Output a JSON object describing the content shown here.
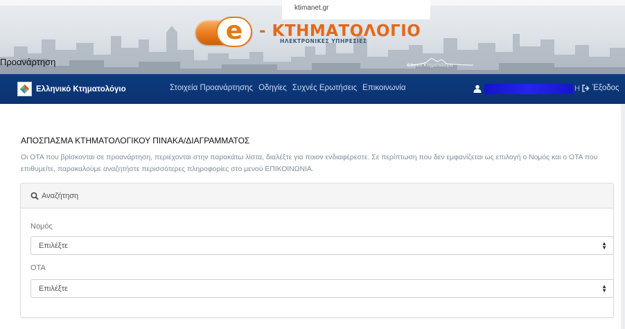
{
  "banner": {
    "url_text": "ktimanet.gr",
    "page_label": "Προανάρτηση",
    "logo_letter": "e",
    "logo_main": "- ΚΤΗΜΑΤΟΛΟΓΙΟ",
    "logo_sub": "ΗΛΕΚΤΡΟΝΙΚΕΣ ΥΠΗΡΕΣΙΕΣ",
    "ek_logo_text": "Εθνικό Κτηματολόγιο"
  },
  "navbar": {
    "brand": "Ελληνικό Κτηματολόγιο",
    "links": [
      "Στοιχεία Προανάρτησης",
      "Οδηγίες",
      "Συχνές Ερωτήσεις",
      "Επικοινωνία"
    ],
    "user_tail": "Η",
    "logout": "Έξοδος",
    "color": "#0d3b7f"
  },
  "main": {
    "title": "ΑΠΟΣΠΑΣΜΑ ΚΤΗΜΑΤΟΛΟΓΙΚΟΥ ΠΙΝΑΚΑ/ΔΙΑΓΡΑΜΜΑΤΟΣ",
    "intro": "Οι ΟΤΑ που βρίσκονται σε προανάρτηση, περιέχονται στην παρακάτω λίστα, διαλέξτε για ποιον ενδιαφέρεστε. Σε περίπτωση που δεν εμφανίζεται ως επιλογή ο Νομός και ο ΟΤΑ που επιθυμείτε, παρακαλούμε αναζητήστε περισσότερες πληροφορίες στο μενού ΕΠΙΚΟΙΝΩΝΙΑ."
  },
  "search": {
    "heading": "Αναζήτηση",
    "nomos_label": "Νομός",
    "nomos_value": "Επιλέξτε",
    "ota_label": "ΟΤΑ",
    "ota_value": "Επιλέξτε"
  }
}
